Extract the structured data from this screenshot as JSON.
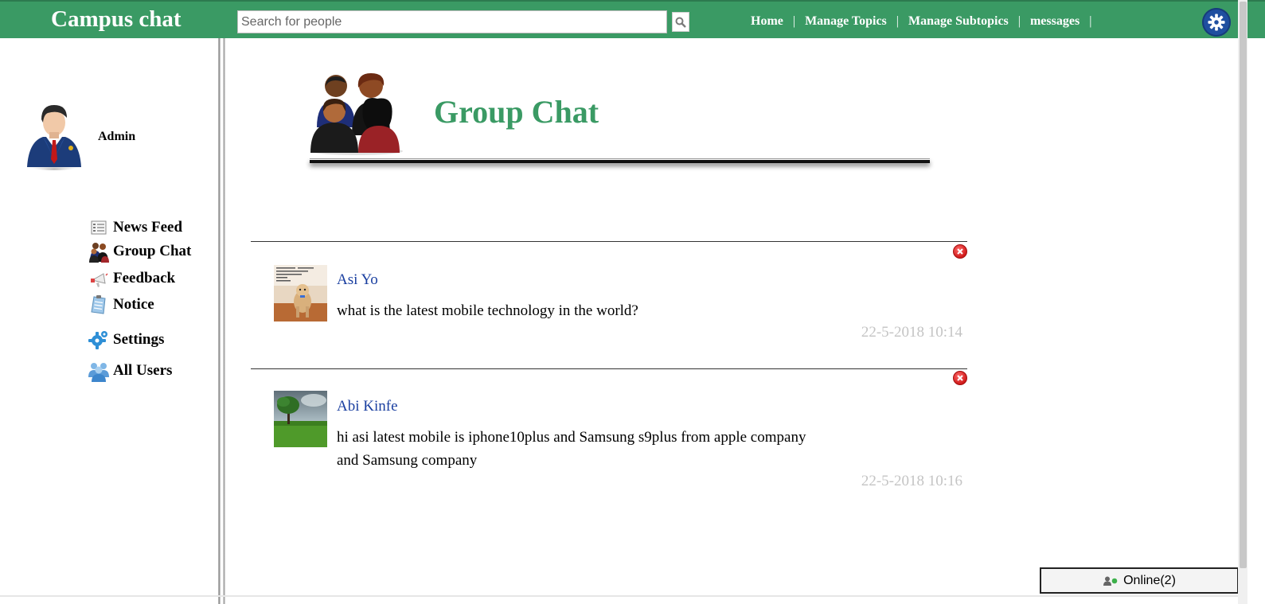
{
  "brand": "Campus chat",
  "search": {
    "placeholder": "Search for people",
    "value": ""
  },
  "nav": {
    "home": "Home",
    "manage_topics": "Manage Topics",
    "manage_subtopics": "Manage Subtopics",
    "messages": "messages",
    "separator": "|"
  },
  "icons": {
    "search": "search-icon",
    "settings": "gear-icon",
    "delete": "delete-icon",
    "online": "online-user-icon"
  },
  "user": {
    "name": "Admin"
  },
  "menu": [
    {
      "label": "News Feed",
      "icon": "news-feed-icon"
    },
    {
      "label": "Group Chat",
      "icon": "group-chat-icon"
    },
    {
      "label": "Feedback",
      "icon": "feedback-icon"
    },
    {
      "label": "Notice",
      "icon": "notice-icon"
    },
    {
      "label": "Settings",
      "icon": "settings-icon"
    },
    {
      "label": "All Users",
      "icon": "all-users-icon"
    }
  ],
  "page": {
    "title": "Group Chat"
  },
  "posts": [
    {
      "author": "Asi Yo",
      "text": "what is the latest mobile technology in the world?",
      "time": "22-5-2018 10:14"
    },
    {
      "author": "Abi Kinfe",
      "text": "hi asi latest mobile is iphone10plus and Samsung s9plus from apple company and Samsung company",
      "time": "22-5-2018 10:16"
    }
  ],
  "online": {
    "label": "Online(2)"
  },
  "colors": {
    "brand_green": "#3a9a64",
    "author_blue": "#1a3fa0",
    "timestamp_gray": "#c4c4c4",
    "gear_blue": "#1f4fa0"
  }
}
